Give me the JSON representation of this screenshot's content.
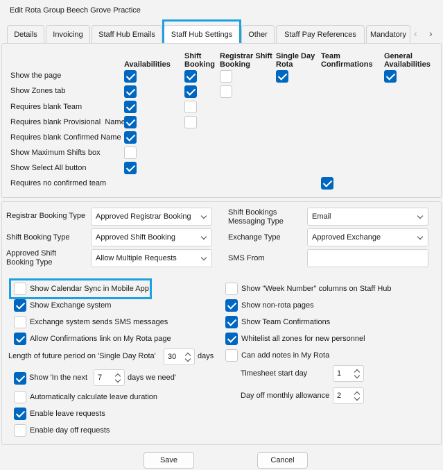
{
  "window": {
    "title": "Edit Rota Group Beech Grove Practice"
  },
  "tabs": [
    {
      "label": "Details"
    },
    {
      "label": "Invoicing"
    },
    {
      "label": "Staff Hub Emails"
    },
    {
      "label": "Staff Hub Settings"
    },
    {
      "label": "Other"
    },
    {
      "label": "Staff Pay References"
    },
    {
      "label": "Mandatory"
    }
  ],
  "tab_nav": {
    "prev": "‹",
    "next": "›"
  },
  "grid": {
    "columns": [
      {
        "label": "Availabilities"
      },
      {
        "label": "Shift Booking"
      },
      {
        "label": "Registrar Shift Booking"
      },
      {
        "label": "Single Day Rota"
      },
      {
        "label": "Team Confirmations"
      },
      {
        "label": "General Availabilities"
      }
    ],
    "rows": [
      {
        "label": "Show the page"
      },
      {
        "label": "Show Zones tab"
      },
      {
        "label": "Requires blank Team"
      },
      {
        "label": "Requires blank Provisional  Name"
      },
      {
        "label": "Requires blank Confirmed Name"
      },
      {
        "label": "Show Maximum Shifts box"
      },
      {
        "label": "Show Select All button"
      },
      {
        "label": "Requires no confirmed team"
      }
    ]
  },
  "fields": {
    "registrar_booking_type": {
      "label": "Registrar Booking Type",
      "value": "Approved Registrar Booking"
    },
    "shift_booking_type": {
      "label": "Shift Booking Type",
      "value": "Approved Shift Booking"
    },
    "approved_shift_booking_type": {
      "label": "Approved Shift Booking Type",
      "value": "Allow Multiple Requests"
    },
    "shift_bookings_messaging_type": {
      "label": "Shift Bookings Messaging Type",
      "value": "Email"
    },
    "exchange_type": {
      "label": "Exchange Type",
      "value": "Approved Exchange"
    },
    "sms_from": {
      "label": "SMS From",
      "value": ""
    }
  },
  "options_left": [
    {
      "label": "Show Calendar Sync in Mobile App",
      "checked": false
    },
    {
      "label": "Show Exchange system",
      "checked": true
    },
    {
      "label": "Exchange system sends SMS messages",
      "checked": false
    },
    {
      "label": "Allow Confirmations link on My Rota page",
      "checked": true
    }
  ],
  "future_period": {
    "label": "Length of future period on 'Single Day Rota'",
    "value": "30",
    "unit": "days"
  },
  "in_the_next": {
    "label_before": "Show 'In the next",
    "value": "7",
    "label_after": "days we need'",
    "checked": true
  },
  "options_left_bottom": [
    {
      "label": "Automatically calculate leave duration",
      "checked": false
    },
    {
      "label": "Enable leave requests",
      "checked": true
    },
    {
      "label": "Enable day off requests",
      "checked": false
    }
  ],
  "options_right": [
    {
      "label": "Show \"Week Number\" columns on Staff Hub",
      "checked": false
    },
    {
      "label": "Show non-rota pages",
      "checked": true
    },
    {
      "label": "Show Team Confirmations",
      "checked": true
    },
    {
      "label": "Whitelist all zones for new personnel",
      "checked": true
    },
    {
      "label": "Can add notes in My Rota",
      "checked": false
    }
  ],
  "timesheet_start_day": {
    "label": "Timesheet start day",
    "value": "1"
  },
  "day_off_allowance": {
    "label": "Day off monthly allowance",
    "value": "2"
  },
  "buttons": {
    "save": "Save",
    "cancel": "Cancel"
  }
}
